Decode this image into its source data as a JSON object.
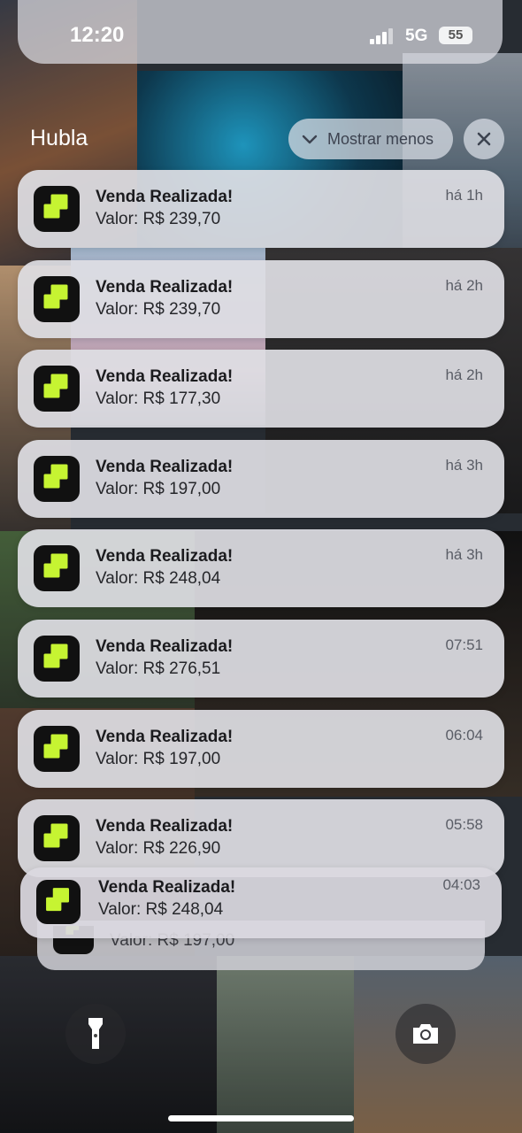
{
  "status_bar": {
    "time": "12:20",
    "network": "5G",
    "battery": "55",
    "icons": [
      "signal-icon",
      "battery-icon"
    ]
  },
  "group": {
    "app_name": "Hubla",
    "show_less_label": "Mostrar menos",
    "icons": [
      "chevron-down-icon",
      "close-icon"
    ]
  },
  "notifications": [
    {
      "title": "Venda Realizada!",
      "body": "Valor: R$ 239,70",
      "time": "há 1h"
    },
    {
      "title": "Venda Realizada!",
      "body": "Valor: R$ 239,70",
      "time": "há 2h"
    },
    {
      "title": "Venda Realizada!",
      "body": "Valor: R$ 177,30",
      "time": "há 2h"
    },
    {
      "title": "Venda Realizada!",
      "body": "Valor: R$ 197,00",
      "time": "há 3h"
    },
    {
      "title": "Venda Realizada!",
      "body": "Valor: R$ 248,04",
      "time": "há 3h"
    },
    {
      "title": "Venda Realizada!",
      "body": "Valor: R$ 276,51",
      "time": "07:51"
    },
    {
      "title": "Venda Realizada!",
      "body": "Valor: R$ 197,00",
      "time": "06:04"
    },
    {
      "title": "Venda Realizada!",
      "body": "Valor: R$ 226,90",
      "time": "05:58"
    },
    {
      "title": "Venda Realizada!",
      "body": "Valor: R$ 248,04",
      "time": "04:03"
    }
  ],
  "stacked_behind": {
    "body": "Valor: R$ 197,00"
  },
  "bottom": {
    "icons": [
      "flashlight-icon",
      "camera-icon"
    ]
  },
  "colors": {
    "app_icon_bg": "#111111",
    "app_icon_accent": "#c6f432"
  }
}
